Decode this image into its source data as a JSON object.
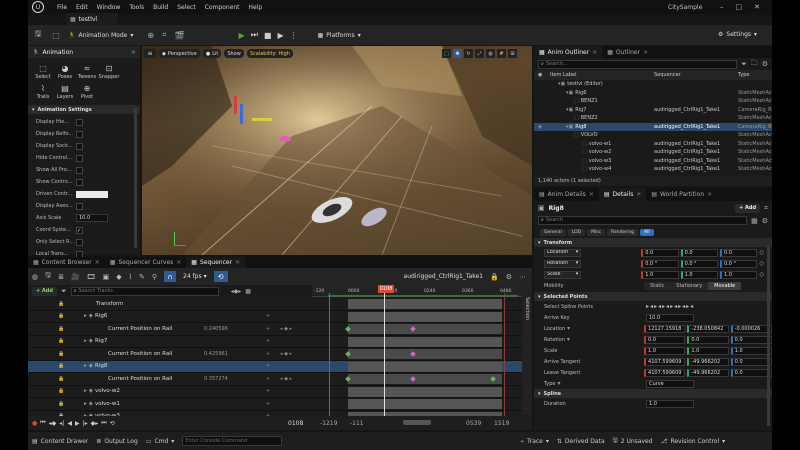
{
  "menubar": {
    "tab": "testlvl",
    "menus": [
      "File",
      "Edit",
      "Window",
      "Tools",
      "Build",
      "Select",
      "Component",
      "Help"
    ],
    "project": "CitySample"
  },
  "toolbar": {
    "mode": "Animation Mode",
    "platforms": "Platforms",
    "settings": "Settings"
  },
  "anim_panel": {
    "title": "Animation",
    "tools": [
      "Select",
      "Poses",
      "Tweens",
      "Snapper",
      "Trails",
      "Layers",
      "Pivot"
    ],
    "settings_header": "Animation Settings",
    "settings": [
      {
        "label": "Display Hie...",
        "type": "check"
      },
      {
        "label": "Display Relfo...",
        "type": "check"
      },
      {
        "label": "Display Sock...",
        "type": "check"
      },
      {
        "label": "Hide Control...",
        "type": "check"
      },
      {
        "label": "Show All Pro...",
        "type": "check"
      },
      {
        "label": "Show Contro...",
        "type": "check"
      },
      {
        "label": "Driven Contr...",
        "type": "color"
      },
      {
        "label": "Display Axes...",
        "type": "check"
      },
      {
        "label": "Axis Scale",
        "type": "value",
        "value": "10.0"
      },
      {
        "label": "Coord Syste...",
        "type": "checked"
      },
      {
        "label": "Only Select R...",
        "type": "check"
      },
      {
        "label": "Local Trans...",
        "type": "check"
      }
    ]
  },
  "viewport": {
    "perspective": "Perspective",
    "lit": "Lit",
    "show": "Show",
    "scalability": "Scalability: High"
  },
  "outliner": {
    "tabs": [
      "Anim Outliner",
      "Outliner"
    ],
    "search_placeholder": "Search...",
    "columns": [
      "Item Label",
      "Sequencer",
      "Type"
    ],
    "rows": [
      {
        "label": "testlvl (Editor)",
        "seq": "",
        "type": "",
        "indent": 1,
        "sel": false
      },
      {
        "label": "Rig6",
        "seq": "",
        "type": "StaticMeshAct",
        "indent": 2,
        "sel": false
      },
      {
        "label": "BENZ1",
        "seq": "",
        "type": "StaticMeshAct",
        "indent": 3,
        "sel": false
      },
      {
        "label": "Rig7",
        "seq": "audirigged_CtrlRig1_Take1",
        "type": "CameraRig_Ra",
        "indent": 2,
        "sel": false
      },
      {
        "label": "BENZ2",
        "seq": "",
        "type": "StaticMeshAct",
        "indent": 3,
        "sel": false
      },
      {
        "label": "Rig8",
        "seq": "audirigged_CtrlRig1_Take1",
        "type": "CameraRig_Ra",
        "indent": 2,
        "sel": true
      },
      {
        "label": "VOLVO",
        "seq": "",
        "type": "StaticMeshAct",
        "indent": 3,
        "sel": false
      },
      {
        "label": "volvo-w1",
        "seq": "audirigged_CtrlRig1_Take1",
        "type": "StaticMeshAct",
        "indent": 4,
        "sel": false
      },
      {
        "label": "volvo-w2",
        "seq": "audirigged_CtrlRig1_Take1",
        "type": "StaticMeshAct",
        "indent": 4,
        "sel": false
      },
      {
        "label": "volvo-w3",
        "seq": "audirigged_CtrlRig1_Take1",
        "type": "StaticMeshAct",
        "indent": 4,
        "sel": false
      },
      {
        "label": "volvo-w4",
        "seq": "audirigged_CtrlRig1_Take1",
        "type": "StaticMeshAct",
        "indent": 4,
        "sel": false
      }
    ],
    "footer": "1,140 actors (1 selected)"
  },
  "details": {
    "tabs": [
      "Anim Details",
      "Details",
      "World Partition"
    ],
    "actor": "Rig8",
    "add_label": "+ Add",
    "search_placeholder": "Search",
    "filters": [
      "General",
      "LOD",
      "Misc",
      "Rendering",
      "All"
    ],
    "transform_header": "Transform",
    "transform": [
      {
        "label": "Location",
        "v": [
          "0.0",
          "0.0",
          "0.0"
        ]
      },
      {
        "label": "Rotation",
        "v": [
          "0.0 °",
          "0.0 °",
          "0.0 °"
        ]
      },
      {
        "label": "Scale",
        "v": [
          "1.0",
          "1.0",
          "1.0"
        ]
      }
    ],
    "mobility_label": "Mobility",
    "mobility": [
      "Static",
      "Stationary",
      "Movable"
    ],
    "selected_points_header": "Selected Points",
    "points": [
      {
        "label": "Select Spline Points",
        "type": "icons"
      },
      {
        "label": "Arrive Key",
        "v": [
          "10.0"
        ]
      },
      {
        "label": "Location",
        "v": [
          "12127.15918",
          "-238.050842",
          "-0.000026"
        ],
        "dd": true
      },
      {
        "label": "Rotation",
        "v": [
          "0.0",
          "0.0",
          "0.0"
        ],
        "dd": true
      },
      {
        "label": "Scale",
        "v": [
          "1.0",
          "1.0",
          "1.0"
        ]
      },
      {
        "label": "Arrive Tangent",
        "v": [
          "4107.599609",
          "-49.966202",
          "0.0"
        ]
      },
      {
        "label": "Leave Tangent",
        "v": [
          "4107.599609",
          "-49.966202",
          "0.0"
        ]
      },
      {
        "label": "Type",
        "v": [
          "Curve"
        ],
        "dd": true
      }
    ],
    "spline_header": "Spline",
    "spline": [
      {
        "label": "Duration",
        "v": [
          "1.0"
        ]
      }
    ]
  },
  "bottom_tabs": [
    "Content Browser",
    "Sequencer Curves",
    "Sequencer"
  ],
  "sequencer": {
    "add_label": "+ Add",
    "fps": "24 fps",
    "sequence_name": "audirigged_CtrlRig1_Take1",
    "search_placeholder": "Search Tracks",
    "ruler": [
      "-120",
      "0000",
      "0120",
      "0240",
      "0360",
      "0480"
    ],
    "playhead": "0108",
    "current_frame": "0108",
    "range_start": "-1219",
    "range_start2": "-111",
    "range_end": "0539",
    "range_end2": "1519",
    "selection_label": "Selection",
    "tracks": [
      {
        "label": "Transform",
        "level": 2,
        "value": "",
        "key": false,
        "sel": false
      },
      {
        "label": "Rig6",
        "level": 1,
        "value": "",
        "key": false,
        "sel": false
      },
      {
        "label": "Current Position on Rail",
        "level": 3,
        "value": "0.240596",
        "key": true,
        "sel": false
      },
      {
        "label": "Rig7",
        "level": 1,
        "value": "",
        "key": false,
        "sel": false
      },
      {
        "label": "Current Position on Rail",
        "level": 3,
        "value": "0.425961",
        "key": true,
        "sel": false
      },
      {
        "label": "Rig8",
        "level": 1,
        "value": "",
        "key": false,
        "sel": true
      },
      {
        "label": "Current Position on Rail",
        "level": 3,
        "value": "0.357274",
        "key": true,
        "sel": false
      },
      {
        "label": "volvo-w2",
        "level": 1,
        "value": "",
        "key": false,
        "sel": false
      },
      {
        "label": "volvo-w1",
        "level": 1,
        "value": "",
        "key": false,
        "sel": false
      },
      {
        "label": "volvo-w3",
        "level": 1,
        "value": "",
        "key": false,
        "sel": false
      }
    ]
  },
  "statusbar": {
    "content_drawer": "Content Drawer",
    "output_log": "Output Log",
    "cmd": "Cmd",
    "console_placeholder": "Enter Console Command",
    "trace": "Trace",
    "derived_data": "Derived Data",
    "unsaved": "2 Unsaved",
    "revision": "Revision Control"
  },
  "colors": {
    "accent": "#2f5c8e",
    "green_play": "#5aa33a",
    "selection": "#2b4a6b",
    "keyframe": "#d068b8"
  }
}
